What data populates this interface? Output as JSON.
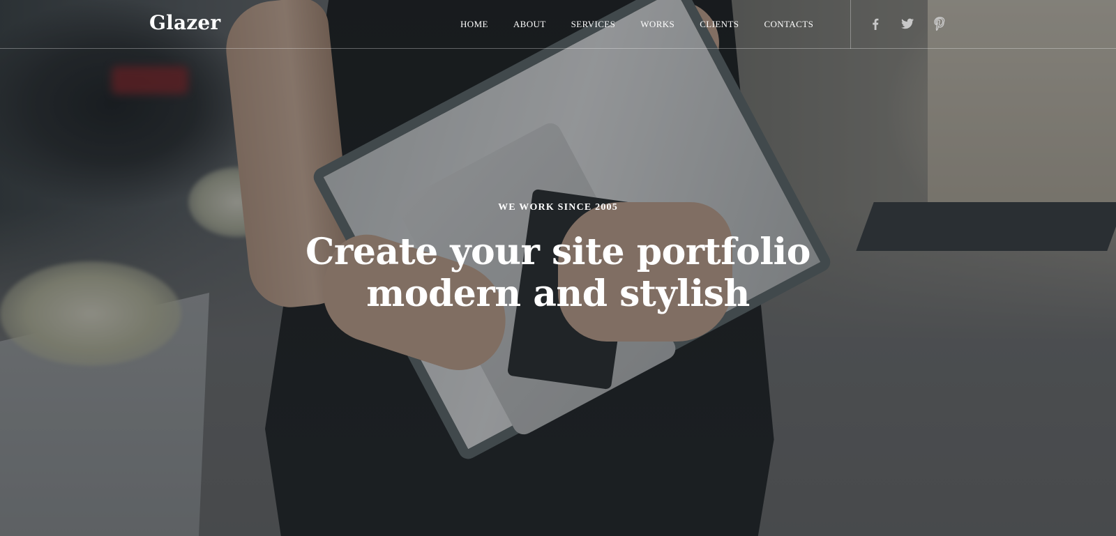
{
  "header": {
    "logo": "Glazer",
    "nav": [
      "HOME",
      "ABOUT",
      "SERVICES",
      "WORKS",
      "CLIENTS",
      "CONTACTS"
    ],
    "social": [
      "facebook-icon",
      "twitter-icon",
      "pinterest-icon"
    ]
  },
  "hero": {
    "eyebrow": "WE WORK SINCE 2005",
    "headline_line1": "Create your site portfolio",
    "headline_line2": "modern and stylish"
  },
  "colors": {
    "text": "#ffffff",
    "icon": "#c8c8c8",
    "divider": "rgba(255,255,255,0.32)"
  }
}
